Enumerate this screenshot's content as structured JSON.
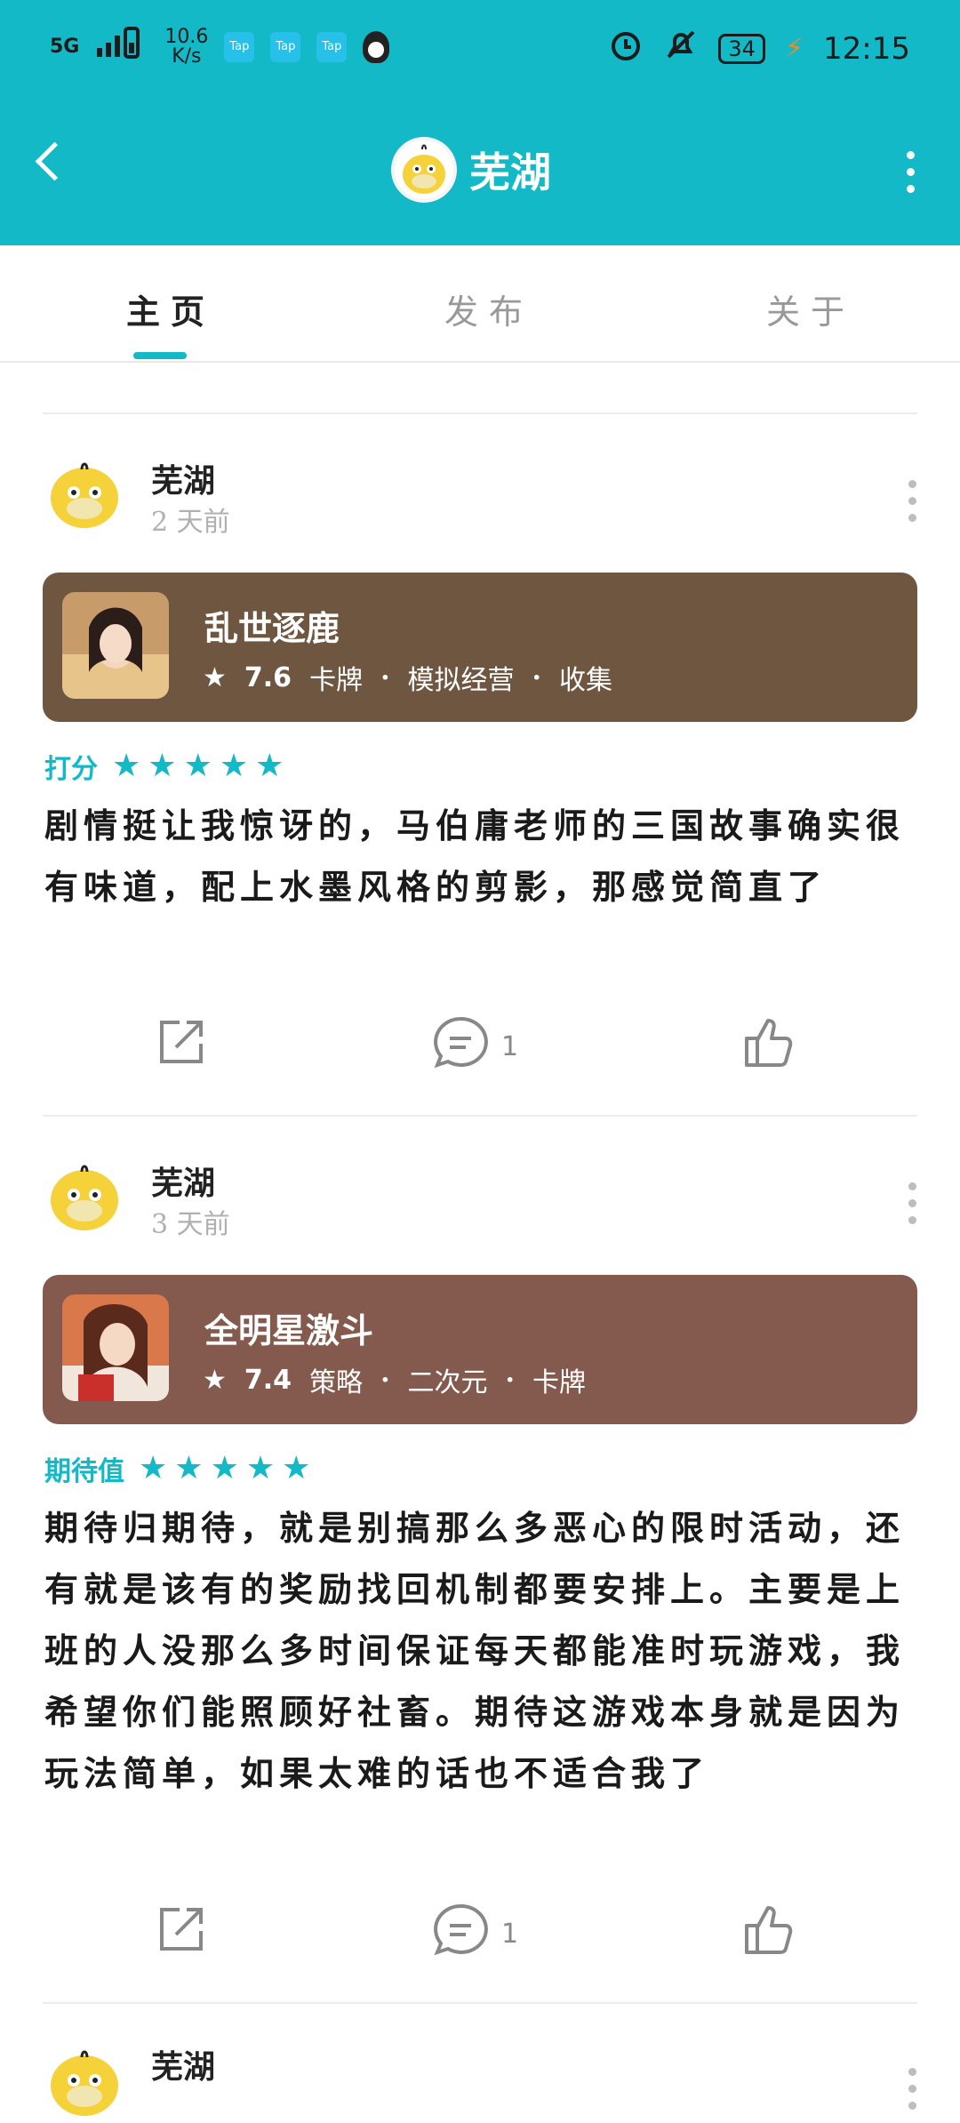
{
  "status_bar": {
    "signal": "5G",
    "speed": "10.6\nK/s",
    "notif_app_label": "Tap",
    "battery": "34",
    "time": "12:15"
  },
  "app_bar": {
    "title": "芜湖"
  },
  "tabs": [
    {
      "label": "主页",
      "active": true
    },
    {
      "label": "发布",
      "active": false
    },
    {
      "label": "关于",
      "active": false
    }
  ],
  "colors": {
    "accent": "#14b9c8",
    "card1_bg": "#6e5641",
    "card2_bg": "#855a4e"
  },
  "posts": [
    {
      "author": "芜湖",
      "time": "2 天前",
      "game": {
        "name": "乱世逐鹿",
        "score": "7.6",
        "tags": [
          "卡牌",
          "模拟经营",
          "收集"
        ]
      },
      "rating_label": "打分",
      "stars": 5,
      "review": "剧情挺让我惊讶的，马伯庸老师的三国故事确实很有味道，配上水墨风格的剪影，那感觉简直了",
      "comments": "1"
    },
    {
      "author": "芜湖",
      "time": "3 天前",
      "game": {
        "name": "全明星激斗",
        "score": "7.4",
        "tags": [
          "策略",
          "二次元",
          "卡牌"
        ]
      },
      "rating_label": "期待值",
      "stars": 5,
      "review": "期待归期待，就是别搞那么多恶心的限时活动，还有就是该有的奖励找回机制都要安排上。主要是上班的人没那么多时间保证每天都能准时玩游戏，我希望你们能照顾好社畜。期待这游戏本身就是因为玩法简单，如果太难的话也不适合我了",
      "comments": "1"
    },
    {
      "author": "芜湖"
    }
  ]
}
